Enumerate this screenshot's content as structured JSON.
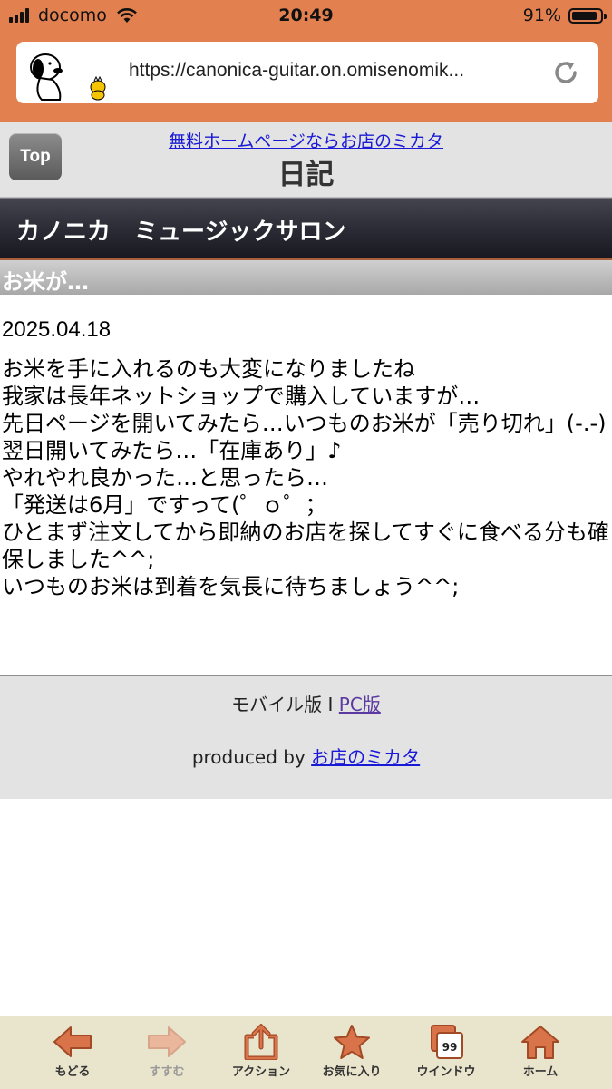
{
  "status": {
    "carrier": "docomo",
    "time": "20:49",
    "battery_percent": "91%",
    "battery_level": 0.91
  },
  "browser": {
    "url": "https://canonica-guitar.on.omisenomik..."
  },
  "header": {
    "top_button": "Top",
    "ad_link": "無料ホームページならお店のミカタ",
    "title": "日記"
  },
  "site": {
    "name": "カノニカ　ミュージックサロン"
  },
  "entry": {
    "title": "お米が…",
    "date": "2025.04.18",
    "lines": [
      "お米を手に入れるのも大変になりましたね",
      "我家は長年ネットショップで購入していますが…",
      "先日ページを開いてみたら…いつものお米が「売り切れ」(-.-)",
      "翌日開いてみたら…「在庫あり」♪",
      "やれやれ良かった…と思ったら…",
      "「発送は6月」ですって(゜ｏ゜；",
      "ひとまず注文してから即納のお店を探してすぐに食べる分も確保しました^^;",
      "いつものお米は到着を気長に待ちましょう^^;"
    ]
  },
  "footer": {
    "mobile_label": "モバイル版 I ",
    "pc_link": "PC版",
    "produced_by": "produced by ",
    "provider_link": "お店のミカタ"
  },
  "toolbar": {
    "back": "もどる",
    "forward": "すすむ",
    "action": "アクション",
    "favorites": "お気に入り",
    "window": "ウインドウ",
    "window_count": "99",
    "home": "ホーム"
  },
  "colors": {
    "chrome": "#e2804f",
    "toolbar_icon": "#d9734a",
    "link": "#1a1ad6"
  }
}
